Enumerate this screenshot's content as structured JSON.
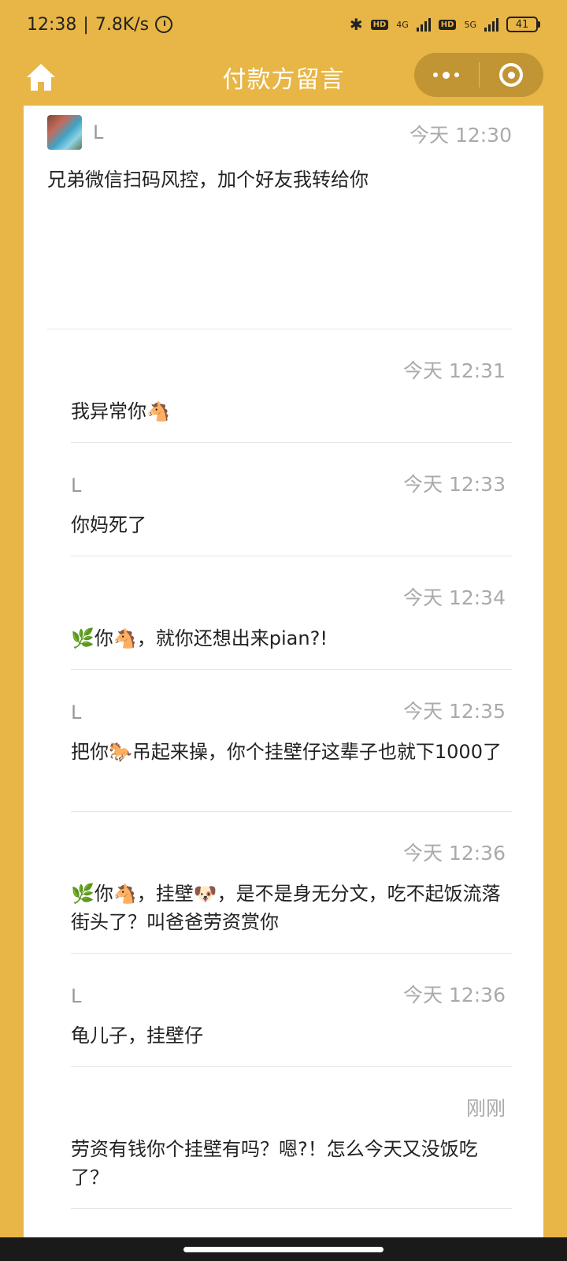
{
  "status_bar": {
    "time": "12:38",
    "speed": "7.8K/s",
    "hd1": "HD",
    "net1": "4G",
    "hd2": "HD",
    "net2": "5G",
    "battery": "41"
  },
  "nav": {
    "title": "付款方留言"
  },
  "colors": {
    "background": "#e8b646",
    "card": "#ffffff",
    "timestamp": "#aaaaaa"
  },
  "first_message": {
    "sender": "L",
    "time": "今天 12:30",
    "content": "兄弟微信扫码风控，加个好友我转给你"
  },
  "replies": [
    {
      "sender": "",
      "time": "今天 12:31",
      "content": "我异常你🐴"
    },
    {
      "sender": "L",
      "time": "今天 12:33",
      "content": "你妈死了"
    },
    {
      "sender": "",
      "time": "今天 12:34",
      "content": "🌿你🐴，就你还想出来pian?!"
    },
    {
      "sender": "L",
      "time": "今天 12:35",
      "content": "把你🐎吊起来操，你个挂壁仔这辈子也就下1000了"
    },
    {
      "sender": "",
      "time": "今天 12:36",
      "content": "🌿你🐴，挂壁🐶，是不是身无分文，吃不起饭流落街头了？叫爸爸劳资赏你"
    },
    {
      "sender": "L",
      "time": "今天 12:36",
      "content": "龟儿子，挂壁仔"
    },
    {
      "sender": "",
      "time": "刚刚",
      "content": "劳资有钱你个挂壁有吗？嗯?！怎么今天又没饭吃了？"
    }
  ]
}
